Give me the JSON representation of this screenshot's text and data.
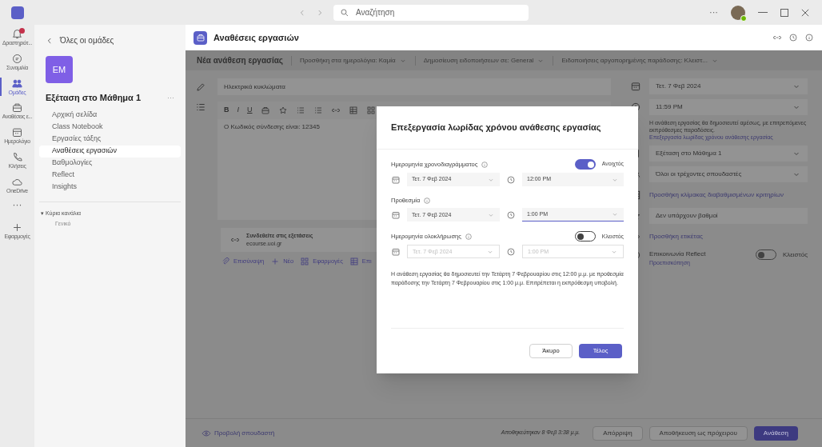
{
  "title_bar": {
    "search": {
      "placeholder": "Αναζήτηση"
    },
    "more": "···"
  },
  "rail": [
    {
      "label": "Δραστηριότ...",
      "selected": false,
      "badge": true
    },
    {
      "label": "Συνομιλία",
      "selected": false,
      "badge": false
    },
    {
      "label": "Ομάδες",
      "selected": true,
      "badge": false
    },
    {
      "label": "Αναθέσεις ε...",
      "selected": false,
      "badge": false
    },
    {
      "label": "Ημερολόγιο",
      "selected": false,
      "badge": false
    },
    {
      "label": "Κλήσεις",
      "selected": false,
      "badge": false
    },
    {
      "label": "OneDrive",
      "selected": false,
      "badge": false
    },
    {
      "label": "···",
      "selected": false,
      "badge": false
    },
    {
      "label": "Εφαρμογές",
      "selected": false,
      "badge": false
    }
  ],
  "sidebar": {
    "back": "Όλες οι ομάδες",
    "avatar": "EM",
    "team": "Εξέταση στο Μάθημα 1",
    "more": "···",
    "items": [
      {
        "label": "Αρχική σελίδα",
        "selected": false
      },
      {
        "label": "Class Notebook",
        "selected": false
      },
      {
        "label": "Εργασίες τάξης",
        "selected": false
      },
      {
        "label": "Αναθέσεις εργασιών",
        "selected": true
      },
      {
        "label": "Βαθμολογίες",
        "selected": false
      },
      {
        "label": "Reflect",
        "selected": false
      },
      {
        "label": "Insights",
        "selected": false
      }
    ],
    "channels_heading": "▾ Κύρια κανάλια",
    "channels": [
      "Γενικό"
    ]
  },
  "app_header": {
    "title": "Αναθέσεις εργασιών"
  },
  "toolbar": {
    "title": "Νέα ανάθεση εργασίας",
    "dropdowns": [
      "Προσθήκη στα ημερολόγια: Καμία",
      "Δημοσίευση ειδοποιήσεων σε: General",
      "Ειδοποιήσεις αργοπορημένης παράδοσης: Κλειστ..."
    ]
  },
  "editor": {
    "title": "Ηλεκτρικά κυκλώματα",
    "format_letters": [
      "B",
      "I",
      "U"
    ],
    "body": "Ο Κωδικός σύνδεσης είναι: 12345",
    "attachment": {
      "name": "Συνδεθείτε στις εξετάσεις",
      "url": "ecourse.uoi.gr"
    },
    "actions": [
      "Επισύναψη",
      "Νέο",
      "Εφαρμογές",
      "Επι"
    ]
  },
  "right_panel": {
    "date": "Τετ. 7 Φεβ 2024",
    "time": "11:59 PM",
    "note": "Η ανάθεση εργασίας θα δημοσιευτεί αμέσως, με επιτρεπόμενες εκπρόθεσμες παραδόσεις.",
    "note_link": "Επεξεργασία λωρίδας χρόνου ανάθεσης εργασίας",
    "rows": [
      {
        "kind": "select",
        "text": "Εξέταση στο Μάθημα 1"
      },
      {
        "kind": "select",
        "text": "Όλοι οι τρέχοντες σπουδαστές"
      },
      {
        "kind": "link",
        "text": "Προσθήκη κλίμακας διαβαθμισμένων κριτηρίων"
      },
      {
        "kind": "field",
        "text": "Δεν υπάρχουν βαθμοί"
      },
      {
        "kind": "link",
        "text": "Προσθήκη ετικέτας"
      }
    ],
    "reflect": {
      "label": "Επικοινωνία Reflect",
      "link": "Προεπισκόπηση",
      "on": false,
      "state": "Κλειστός"
    }
  },
  "bottom_bar": {
    "preview": "Προβολή σπουδαστή",
    "saved": "Αποθηκεύτηκαν 8 Φεβ 3:38 μ.μ.",
    "buttons": [
      "Απόρριψη",
      "Αποθήκευση ως πρόχειρου",
      "Ανάθεση"
    ]
  },
  "dialog": {
    "title": "Επεξεργασία λωρίδας χρόνου ανάθεσης εργασίας",
    "sections": [
      {
        "label": "Ημερομηνία χρονοδιαγράμματος",
        "toggle": {
          "on": true,
          "state": "Ανοιχτός"
        },
        "date": "Τετ. 7 Φεβ 2024",
        "time": "12:00 PM",
        "disabled": false,
        "focused": false
      },
      {
        "label": "Προθεσμία",
        "date": "Τετ. 7 Φεβ 2024",
        "time": "1:00 PM",
        "disabled": false,
        "focused": true
      },
      {
        "label": "Ημερομηνία ολοκλήρωσης",
        "toggle": {
          "on": false,
          "state": "Κλειστός"
        },
        "date": "Τετ. 7 Φεβ 2024",
        "time": "1:00 PM",
        "disabled": true,
        "focused": false
      }
    ],
    "summary": "Η ανάθεση εργασίας θα δημοσιευτεί την Τετάρτη 7 Φεβρουαρίου στις 12:00 μ.μ. με προθεσμία παράδοσης την Τετάρτη 7 Φεβρουαρίου στις 1:00 μ.μ. Επιτρέπεται η εκπρόθεσμη υποβολή.",
    "buttons": [
      {
        "label": "Άκυρο",
        "primary": false
      },
      {
        "label": "Τέλος",
        "primary": true
      }
    ]
  }
}
